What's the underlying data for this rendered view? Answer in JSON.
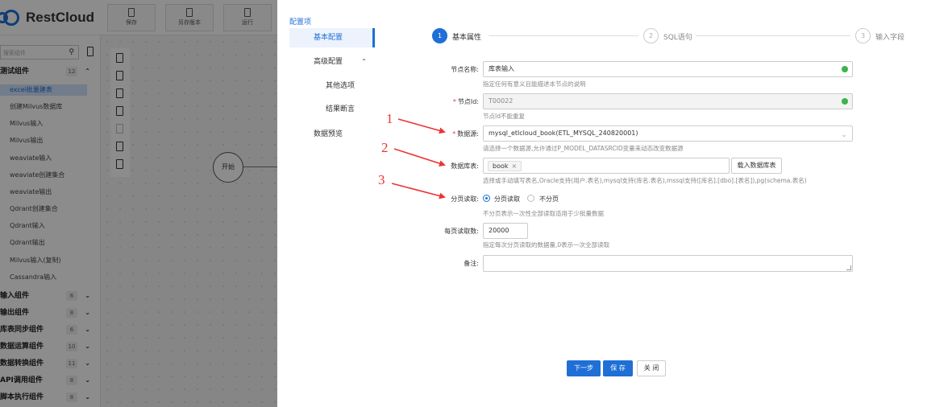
{
  "app": {
    "logo_text": "RestCloud",
    "toolbar": [
      {
        "label": "保存"
      },
      {
        "label": "另存版本"
      },
      {
        "label": "运行"
      }
    ],
    "search_placeholder": "搜索组件",
    "groups": [
      {
        "label": "测试组件",
        "count": "12",
        "expanded": true,
        "items": [
          "excel批量建表",
          "创建Milvus数据库",
          "Milvus输入",
          "Milvus输出",
          "weaviate输入",
          "weaviate创建集合",
          "weaviate输出",
          "Qdrant创建集合",
          "Qdrant输入",
          "Qdrant输出",
          "Milvus输入(复制)",
          "Cassandra输入"
        ],
        "selected": 0
      },
      {
        "label": "输入组件",
        "count": "6"
      },
      {
        "label": "输出组件",
        "count": "8"
      },
      {
        "label": "库表同步组件",
        "count": "6"
      },
      {
        "label": "数据运算组件",
        "count": "10"
      },
      {
        "label": "数据转换组件",
        "count": "11"
      },
      {
        "label": "API调用组件",
        "count": "8"
      },
      {
        "label": "脚本执行组件",
        "count": "8"
      }
    ],
    "start_node": "开始"
  },
  "drawer": {
    "nav_header": "配置项",
    "nav": [
      {
        "label": "基本配置",
        "active": true
      },
      {
        "label": "高级配置",
        "expanded": true
      },
      {
        "label": "其他选项"
      },
      {
        "label": "结果断言"
      },
      {
        "label": "数据预览"
      }
    ],
    "steps": [
      {
        "num": "1",
        "label": "基本属性",
        "active": true
      },
      {
        "num": "2",
        "label": "SQL语句",
        "active": false
      },
      {
        "num": "3",
        "label": "输入字段",
        "active": false
      }
    ],
    "form": {
      "node_name": {
        "label": "节点名称:",
        "value": "库表输入",
        "hint": "指定任何有意义且能描述本节点的说明"
      },
      "node_id": {
        "label": "节点Id:",
        "value": "T00022",
        "hint": "节点Id不能重复"
      },
      "datasource": {
        "label": "数据源:",
        "value": "mysql_etlcloud_book(ETL_MYSQL_240820001)",
        "hint": "请选择一个数据源,允许通过P_MODEL_DATASRCID变量来动态改变数据源"
      },
      "table": {
        "label": "数据库表:",
        "tag": "book",
        "tag_close": "×",
        "load_button": "载入数据库表",
        "hint": "选择或手动填写表名,Oracle支持(用户.表名),mysql支持(库名.表名),mssql支持([库名].[dbo].[表名]),pg(schema.表名)"
      },
      "paging": {
        "label": "分页读取:",
        "options": [
          "分页读取",
          "不分页"
        ],
        "selected": 0,
        "hint": "不分页表示一次性全部读取适用于少批量数据"
      },
      "page_size": {
        "label": "每页读取数:",
        "value": "20000",
        "hint": "指定每次分页读取的数据量,0表示一次全部读取"
      },
      "remark": {
        "label": "备注:",
        "value": ""
      }
    },
    "buttons": {
      "next": "下一步",
      "save": "保 存",
      "close": "关 闭"
    }
  },
  "annotations": {
    "nums": [
      "1",
      "2",
      "3"
    ],
    "color": "#e33333"
  },
  "colors": {
    "accent": "#1f6fd6",
    "success": "#3bb54a",
    "required": "#e33333"
  }
}
